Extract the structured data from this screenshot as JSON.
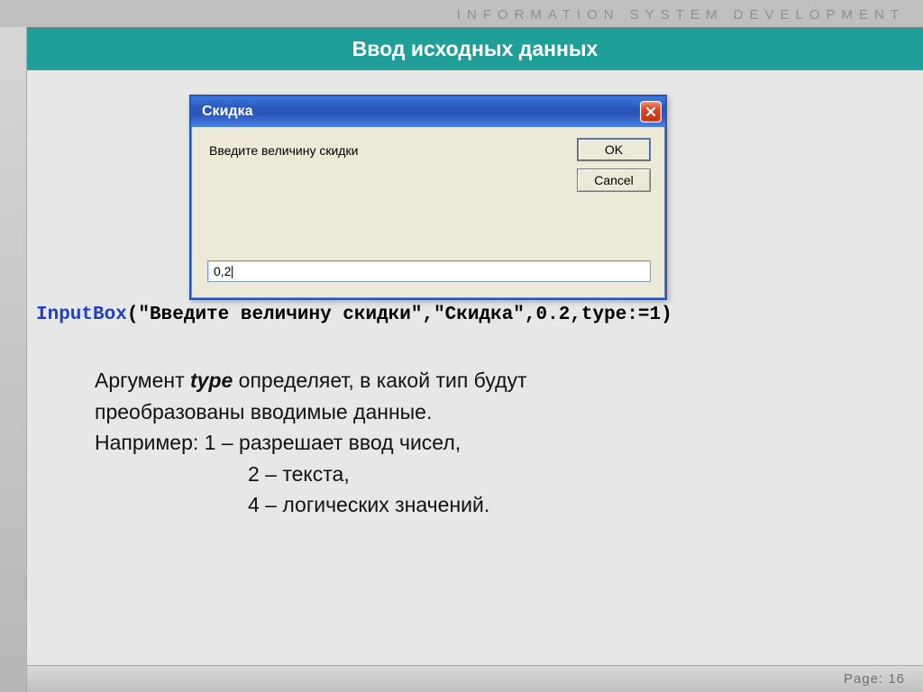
{
  "tagline": "INFORMATION SYSTEM  DEVELOPMENT",
  "title": "Ввод исходных данных",
  "footer": {
    "label": "Page:",
    "number": "16"
  },
  "dialog": {
    "title": "Скидка",
    "prompt": "Введите величину скидки",
    "ok": "OK",
    "cancel": "Cancel",
    "value": "0,2"
  },
  "code": {
    "keyword": "InputBox",
    "rest": "(\"Введите величину скидки\",\"Скидка\",0.2,type:=1)"
  },
  "explain": {
    "p1a": "Аргумент ",
    "arg": "type",
    "p1b": "  определяет, в какой тип будут",
    "p2": "преобразованы вводимые данные.",
    "p3": "Например:  1 – разрешает ввод чисел,",
    "p4": "2 – текста,",
    "p5": "4 – логических значений."
  }
}
